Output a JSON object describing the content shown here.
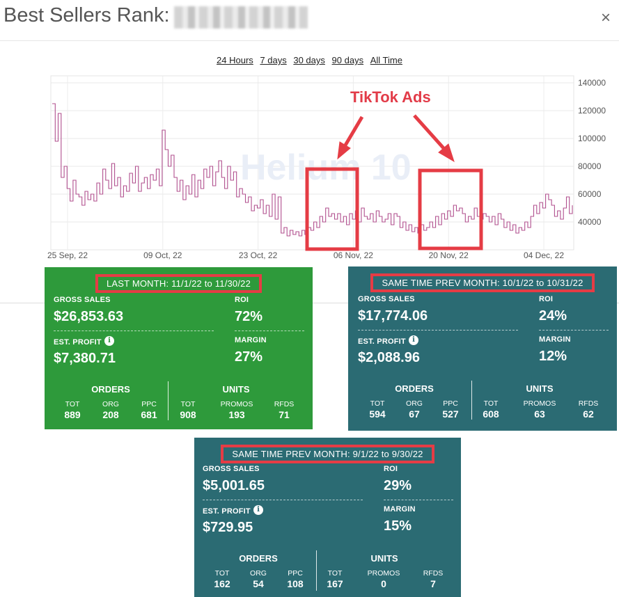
{
  "header": {
    "title": "Best Sellers Rank:",
    "close_symbol": "×"
  },
  "ranges": [
    "24 Hours",
    "7 days",
    "30 days",
    "90 days",
    "All Time"
  ],
  "annotation": {
    "text": "TikTok Ads",
    "color": "#e23b48"
  },
  "chart_data": {
    "type": "line",
    "x_tick_labels": [
      "25 Sep, 22",
      "09 Oct, 22",
      "23 Oct, 22",
      "06 Nov, 22",
      "20 Nov, 22",
      "04 Dec, 22"
    ],
    "y_tick_labels": [
      "40000",
      "60000",
      "80000",
      "100000",
      "120000",
      "140000"
    ],
    "ylim": [
      20000,
      145000
    ],
    "grid": true,
    "line_color": "#b04f8e",
    "watermark": "Helium 10",
    "series": [
      {
        "values": [
          125000,
          98000,
          118000,
          72000,
          80000,
          64000,
          55000,
          70000,
          60000,
          58000,
          52000,
          62000,
          56000,
          60000,
          55000,
          68000,
          60000,
          78000,
          70000,
          64000,
          82000,
          66000,
          72000,
          58000,
          66000,
          62000,
          75000,
          68000,
          80000,
          62000,
          68000,
          72000,
          64000,
          74000,
          70000,
          78000,
          66000,
          106000,
          92000,
          80000,
          88000,
          72000,
          62000,
          70000,
          56000,
          66000,
          60000,
          74000,
          58000,
          70000,
          64000,
          78000,
          72000,
          80000,
          66000,
          76000,
          84000,
          72000,
          64000,
          80000,
          70000,
          76000,
          58000,
          64000,
          60000,
          54000,
          58000,
          48000,
          52000,
          50000,
          56000,
          46000,
          52000,
          44000,
          60000,
          42000,
          58000,
          32000,
          36000,
          30000,
          34000,
          31000,
          33000,
          30000,
          34000,
          31000,
          36000,
          34000,
          40000,
          36000,
          44000,
          40000,
          50000,
          44000,
          46000,
          42000,
          46000,
          40000,
          44000,
          38000,
          46000,
          42000,
          48000,
          40000,
          50000,
          44000,
          42000,
          46000,
          40000,
          48000,
          44000,
          40000,
          42000,
          46000,
          38000,
          46000,
          44000,
          36000,
          40000,
          34000,
          38000,
          33000,
          36000,
          32000,
          38000,
          34000,
          36000,
          40000,
          36000,
          44000,
          38000,
          46000,
          42000,
          48000,
          44000,
          52000,
          48000,
          50000,
          46000,
          40000,
          44000,
          42000,
          50000,
          44000,
          42000,
          46000,
          44000,
          40000,
          44000,
          38000,
          46000,
          42000,
          36000,
          40000,
          34000,
          38000,
          32000,
          36000,
          34000,
          40000,
          36000,
          44000,
          52000,
          46000,
          54000,
          50000,
          60000,
          56000,
          52000,
          44000,
          48000,
          42000,
          50000,
          58000,
          46000,
          52000
        ]
      }
    ],
    "highlight_boxes": [
      "TikTok Ads window 1",
      "TikTok Ads window 2"
    ]
  },
  "cards": [
    {
      "heading": "LAST MONTH: 11/1/22 to 11/30/22",
      "gross_sales_label": "GROSS SALES",
      "gross_sales": "$26,853.63",
      "roi_label": "ROI",
      "roi": "72%",
      "profit_label": "EST. PROFIT",
      "profit": "$7,380.71",
      "margin_label": "MARGIN",
      "margin": "27%",
      "orders_title": "ORDERS",
      "units_title": "UNITS",
      "orders": [
        {
          "label": "TOT",
          "value": "889"
        },
        {
          "label": "ORG",
          "value": "208"
        },
        {
          "label": "PPC",
          "value": "681"
        }
      ],
      "units": [
        {
          "label": "TOT",
          "value": "908"
        },
        {
          "label": "PROMOS",
          "value": "193"
        },
        {
          "label": "RFDS",
          "value": "71"
        }
      ]
    },
    {
      "heading": "SAME TIME PREV MONTH: 10/1/22 to 10/31/22",
      "gross_sales_label": "GROSS SALES",
      "gross_sales": "$17,774.06",
      "roi_label": "ROI",
      "roi": "24%",
      "profit_label": "EST. PROFIT",
      "profit": "$2,088.96",
      "margin_label": "MARGIN",
      "margin": "12%",
      "orders_title": "ORDERS",
      "units_title": "UNITS",
      "orders": [
        {
          "label": "TOT",
          "value": "594"
        },
        {
          "label": "ORG",
          "value": "67"
        },
        {
          "label": "PPC",
          "value": "527"
        }
      ],
      "units": [
        {
          "label": "TOT",
          "value": "608"
        },
        {
          "label": "PROMOS",
          "value": "63"
        },
        {
          "label": "RFDS",
          "value": "62"
        }
      ]
    },
    {
      "heading": "SAME TIME PREV MONTH: 9/1/22 to 9/30/22",
      "gross_sales_label": "GROSS SALES",
      "gross_sales": "$5,001.65",
      "roi_label": "ROI",
      "roi": "29%",
      "profit_label": "EST. PROFIT",
      "profit": "$729.95",
      "margin_label": "MARGIN",
      "margin": "15%",
      "orders_title": "ORDERS",
      "units_title": "UNITS",
      "orders": [
        {
          "label": "TOT",
          "value": "162"
        },
        {
          "label": "ORG",
          "value": "54"
        },
        {
          "label": "PPC",
          "value": "108"
        }
      ],
      "units": [
        {
          "label": "TOT",
          "value": "167"
        },
        {
          "label": "PROMOS",
          "value": "0"
        },
        {
          "label": "RFDS",
          "value": "7"
        }
      ]
    }
  ],
  "colors": {
    "green_card": "#2e9a3b",
    "teal_card": "#2b6b73",
    "highlight_red": "#e53c45"
  }
}
